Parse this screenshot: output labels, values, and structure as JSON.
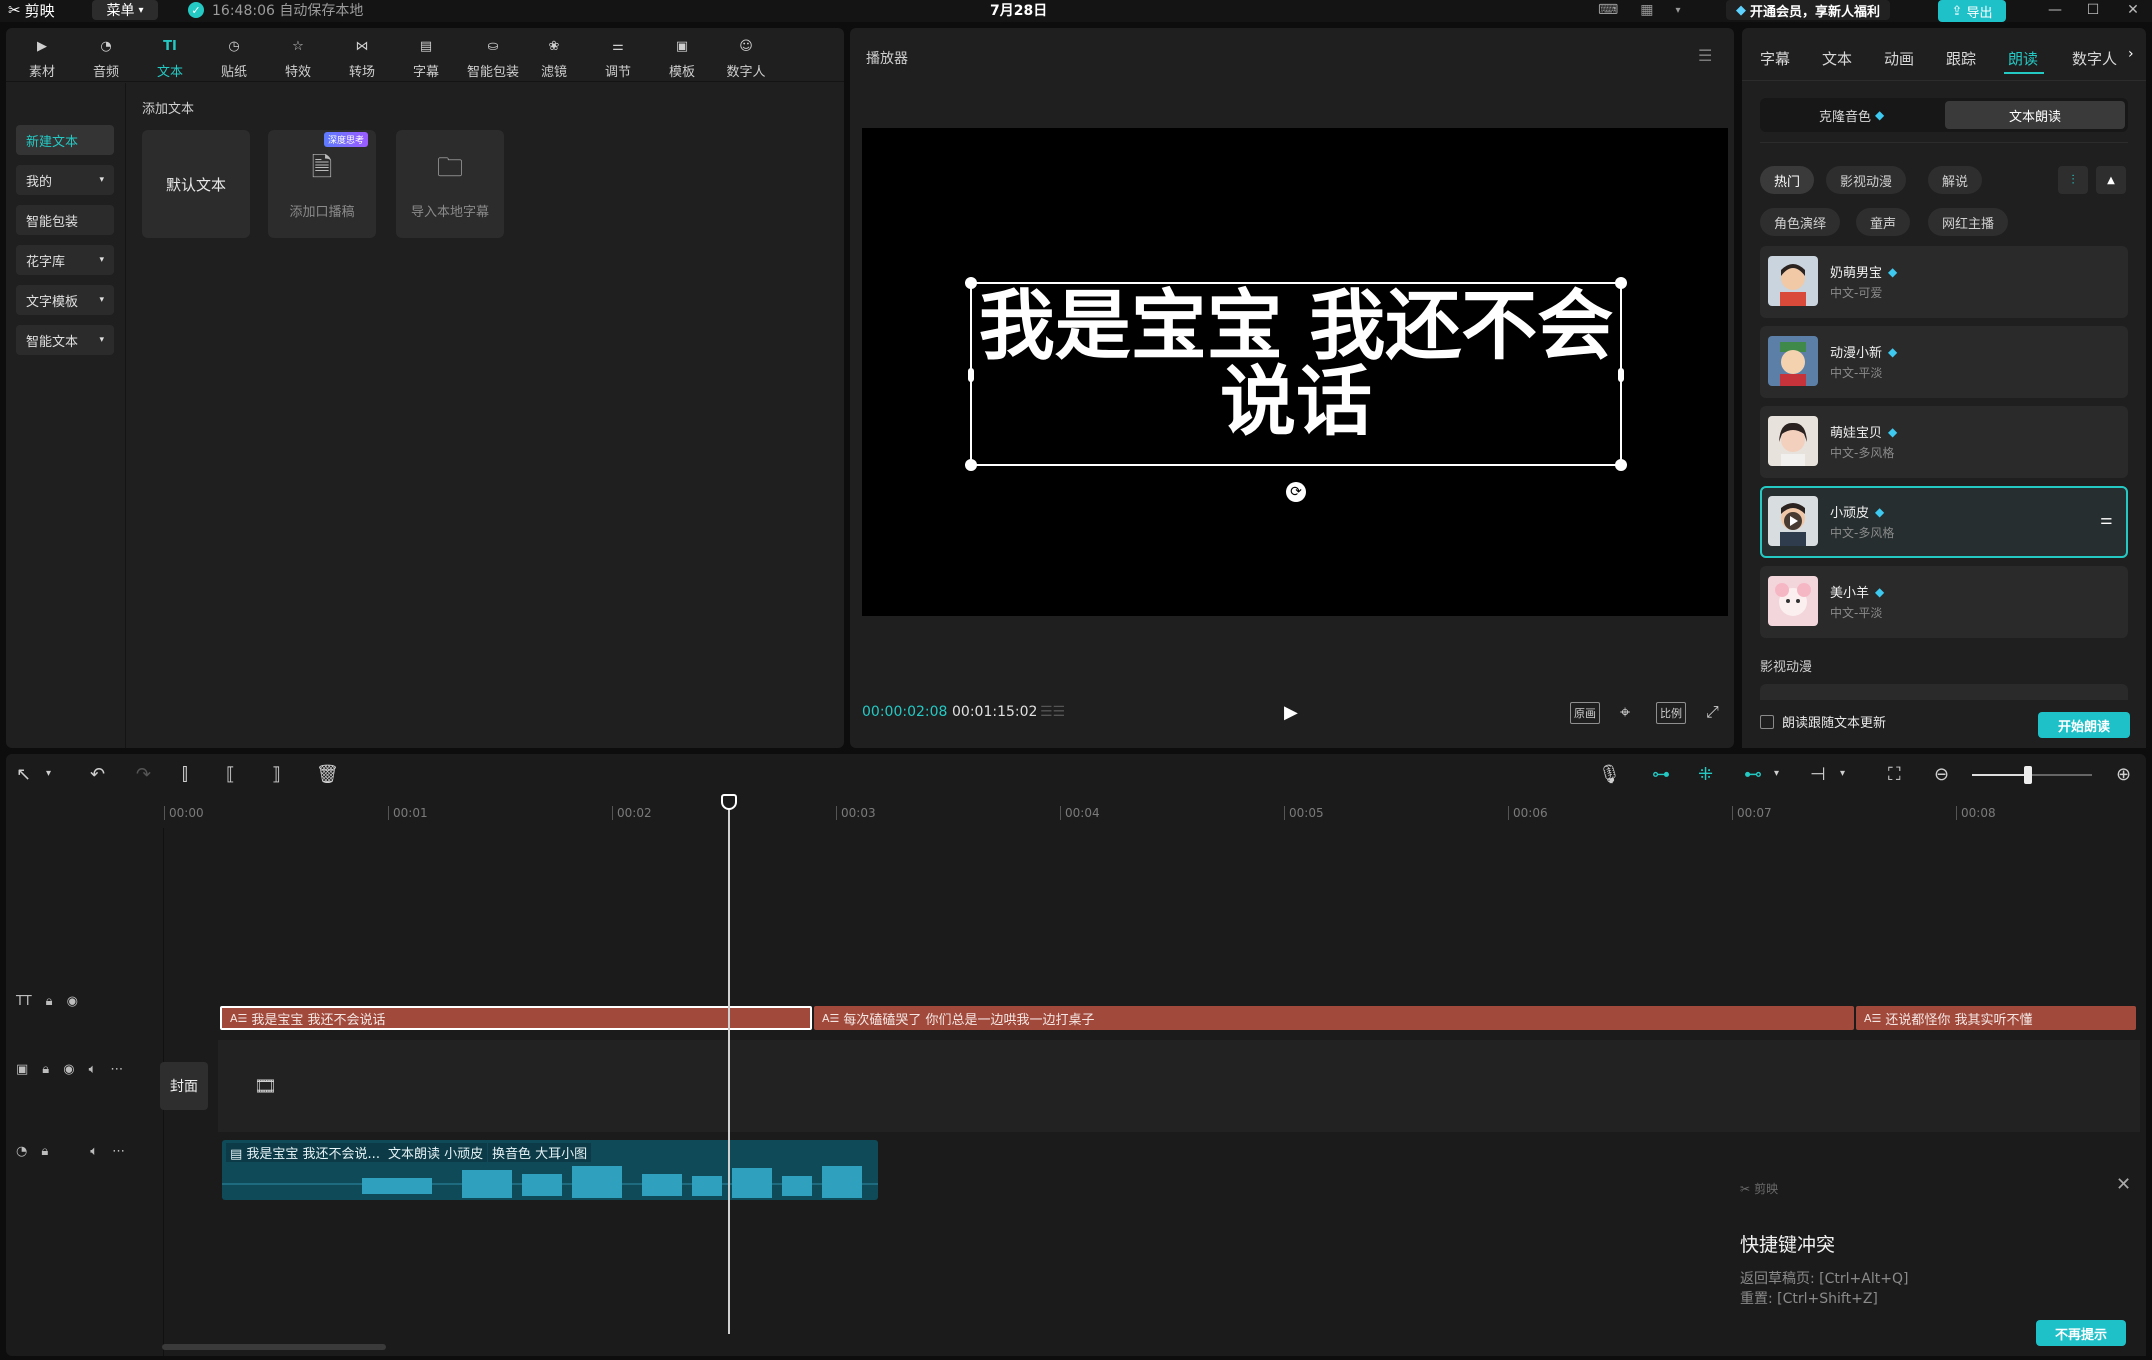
{
  "app": {
    "name": "剪映",
    "menu_label": "菜单",
    "autosave": "16:48:06 自动保存本地",
    "project_title": "7月28日",
    "vip_label": "开通会员，享新人福利",
    "export_label": "导出"
  },
  "top_tabs": [
    "素材",
    "音频",
    "文本",
    "贴纸",
    "特效",
    "转场",
    "字幕",
    "智能包装",
    "滤镜",
    "调节",
    "模板",
    "数字人"
  ],
  "text_nav": [
    {
      "label": "新建文本",
      "dropdown": false
    },
    {
      "label": "我的",
      "dropdown": true
    },
    {
      "label": "智能包装",
      "dropdown": false
    },
    {
      "label": "花字库",
      "dropdown": true
    },
    {
      "label": "文字模板",
      "dropdown": true
    },
    {
      "label": "智能文本",
      "dropdown": true
    }
  ],
  "add_text": {
    "title": "添加文本",
    "cards": [
      "默认文本",
      "添加口播稿",
      "导入本地字幕"
    ],
    "badge": "深度思考"
  },
  "player": {
    "title": "播放器",
    "caption": "我是宝宝 我还不会说话",
    "time_current": "00:00:02:08",
    "time_total": "00:01:15:02",
    "ctl_original": "原画",
    "ctl_ratio": "比例"
  },
  "right_panel": {
    "tabs": [
      "字幕",
      "文本",
      "动画",
      "跟踪",
      "朗读",
      "数字人"
    ],
    "active_tab": "朗读",
    "segments": [
      "克隆音色",
      "文本朗读"
    ],
    "chips": [
      "热门",
      "影视动漫",
      "解说",
      "角色演绎",
      "童声",
      "网红主播"
    ],
    "voices": [
      {
        "name": "奶萌男宝",
        "desc": "中文-可爱"
      },
      {
        "name": "动漫小新",
        "desc": "中文-平淡"
      },
      {
        "name": "萌娃宝贝",
        "desc": "中文-多风格"
      },
      {
        "name": "小顽皮",
        "desc": "中文-多风格"
      },
      {
        "name": "美小羊",
        "desc": "中文-平淡"
      }
    ],
    "section2": "影视动漫",
    "follow_label": "朗读跟随文本更新",
    "start_label": "开始朗读"
  },
  "timeline": {
    "ticks": [
      "00:00",
      "00:01",
      "00:02",
      "00:03",
      "00:04",
      "00:05",
      "00:06",
      "00:07",
      "00:08"
    ],
    "cover_label": "封面",
    "text_clips": [
      "我是宝宝 我还不会说话",
      "每次磕磕哭了 你们总是一边哄我一边打桌子",
      "还说都怪你 我其实听不懂"
    ],
    "audio_labels": [
      "我是宝宝 我还不会说...",
      "文本朗读 小顽皮",
      "换音色 大耳小图"
    ]
  },
  "toast": {
    "brand": "剪映",
    "title": "快捷键冲突",
    "line1": "返回草稿页: [Ctrl+Alt+Q]",
    "line2": "重置: [Ctrl+Shift+Z]",
    "button": "不再提示"
  },
  "colors": {
    "accent": "#25c9c4",
    "text_clip": "#a14a3c",
    "audio_clip": "#0f4a59"
  }
}
